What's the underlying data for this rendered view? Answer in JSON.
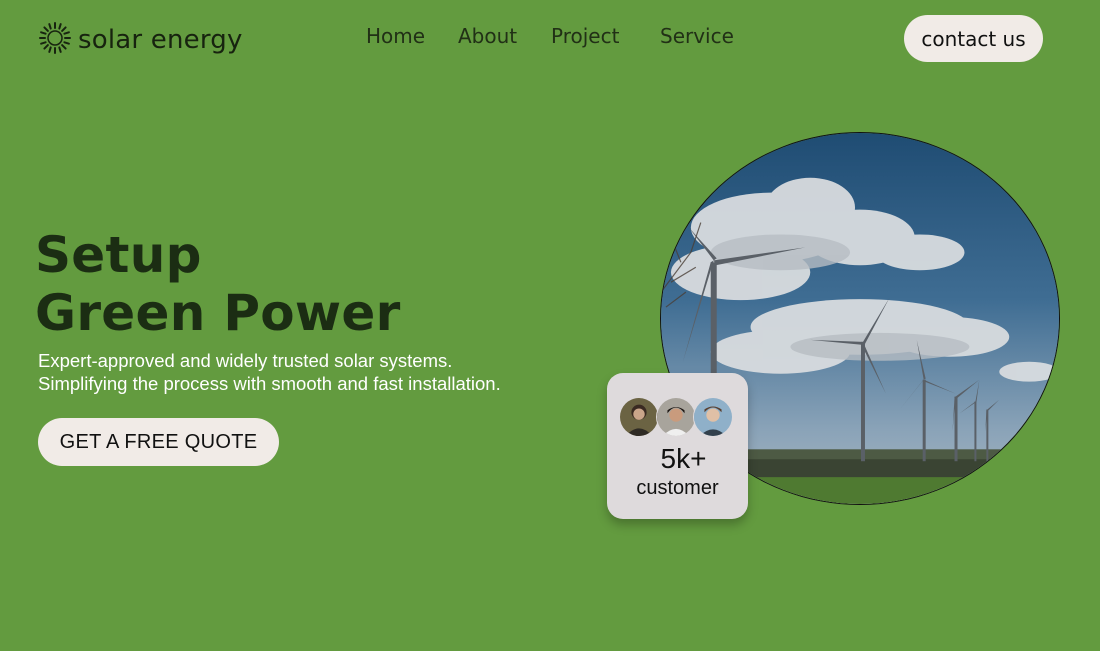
{
  "brand": {
    "name": "solar energy",
    "icon": "sun-icon",
    "background_color": "#639b3f",
    "button_color": "#f1ebe7"
  },
  "nav": {
    "items": [
      {
        "label": "Home"
      },
      {
        "label": "About"
      },
      {
        "label": "Project"
      },
      {
        "label": "Service"
      }
    ],
    "contact_label": "contact us"
  },
  "hero": {
    "title_line1": "Setup",
    "title_line2": "Green Power",
    "subtitle_line1": "Expert-approved and widely trusted solar systems.",
    "subtitle_line2": "Simplifying the process with smooth and fast installation.",
    "cta_label": "GET A FREE QUOTE",
    "image": "wind-turbines-photo"
  },
  "stats": {
    "number": "5k+",
    "label": "customer",
    "avatars": [
      "avatar-1",
      "avatar-2",
      "avatar-3"
    ]
  }
}
